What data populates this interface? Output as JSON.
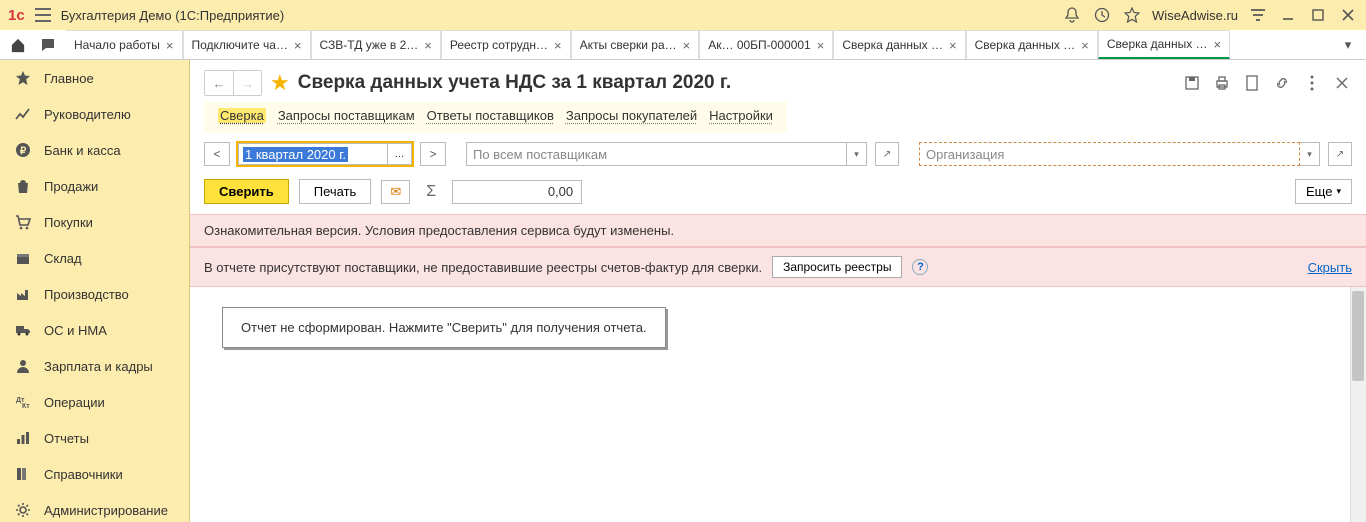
{
  "titlebar": {
    "app_title": "Бухгалтерия Демо  (1С:Предприятие)",
    "brand": "WiseAdwise.ru"
  },
  "tabs": [
    {
      "label": "Начало работы",
      "closable": true
    },
    {
      "label": "Подключите ча…",
      "closable": true
    },
    {
      "label": "СЗВ-ТД уже в 2…",
      "closable": true
    },
    {
      "label": "Реестр сотрудн…",
      "closable": true
    },
    {
      "label": "Акты сверки ра…",
      "closable": true
    },
    {
      "label": "Ак… 00БП-000001",
      "closable": true
    },
    {
      "label": "Сверка данных …",
      "closable": true
    },
    {
      "label": "Сверка данных …",
      "closable": true
    },
    {
      "label": "Сверка данных …",
      "closable": true,
      "active": true
    }
  ],
  "sidebar": [
    {
      "label": "Главное",
      "icon": "star"
    },
    {
      "label": "Руководителю",
      "icon": "chart"
    },
    {
      "label": "Банк и касса",
      "icon": "ruble"
    },
    {
      "label": "Продажи",
      "icon": "bag"
    },
    {
      "label": "Покупки",
      "icon": "cart"
    },
    {
      "label": "Склад",
      "icon": "box"
    },
    {
      "label": "Производство",
      "icon": "factory"
    },
    {
      "label": "ОС и НМА",
      "icon": "truck"
    },
    {
      "label": "Зарплата и кадры",
      "icon": "person"
    },
    {
      "label": "Операции",
      "icon": "ops"
    },
    {
      "label": "Отчеты",
      "icon": "bars"
    },
    {
      "label": "Справочники",
      "icon": "books"
    },
    {
      "label": "Администрирование",
      "icon": "gear"
    }
  ],
  "page": {
    "title": "Сверка данных учета НДС за 1 квартал 2020 г.",
    "subtabs": [
      "Сверка",
      "Запросы поставщикам",
      "Ответы поставщиков",
      "Запросы покупателей",
      "Настройки"
    ],
    "active_subtab": 0,
    "period_value": "1 квартал 2020 г.",
    "supplier_placeholder": "По всем поставщикам",
    "org_placeholder": "Организация",
    "verify_label": "Сверить",
    "print_label": "Печать",
    "total_value": "0,00",
    "more_label": "Еще",
    "banner1": "Ознакомительная версия. Условия предоставления сервиса будут изменены.",
    "banner2_text": "В отчете присутствуют поставщики, не предоставившие реестры счетов-фактур для сверки.",
    "banner2_button": "Запросить реестры",
    "banner2_hide": "Скрыть",
    "report_placeholder": "Отчет не сформирован. Нажмите \"Сверить\" для получения отчета."
  }
}
